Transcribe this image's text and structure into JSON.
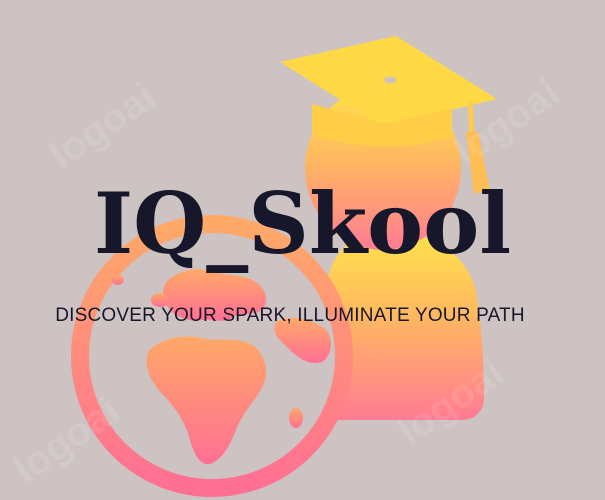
{
  "brand": {
    "name": "IQ_Skool",
    "tagline": "DISCOVER YOUR SPARK, ILLUMINATE YOUR PATH"
  },
  "watermark": {
    "text": "logoai"
  },
  "colors": {
    "background": "#cdc3c2",
    "text": "#17172b",
    "gradient_top": "#ffd845",
    "gradient_bottom": "#ff7c93"
  },
  "icons": {
    "graduate": "graduate-person-icon",
    "globe": "globe-icon"
  }
}
